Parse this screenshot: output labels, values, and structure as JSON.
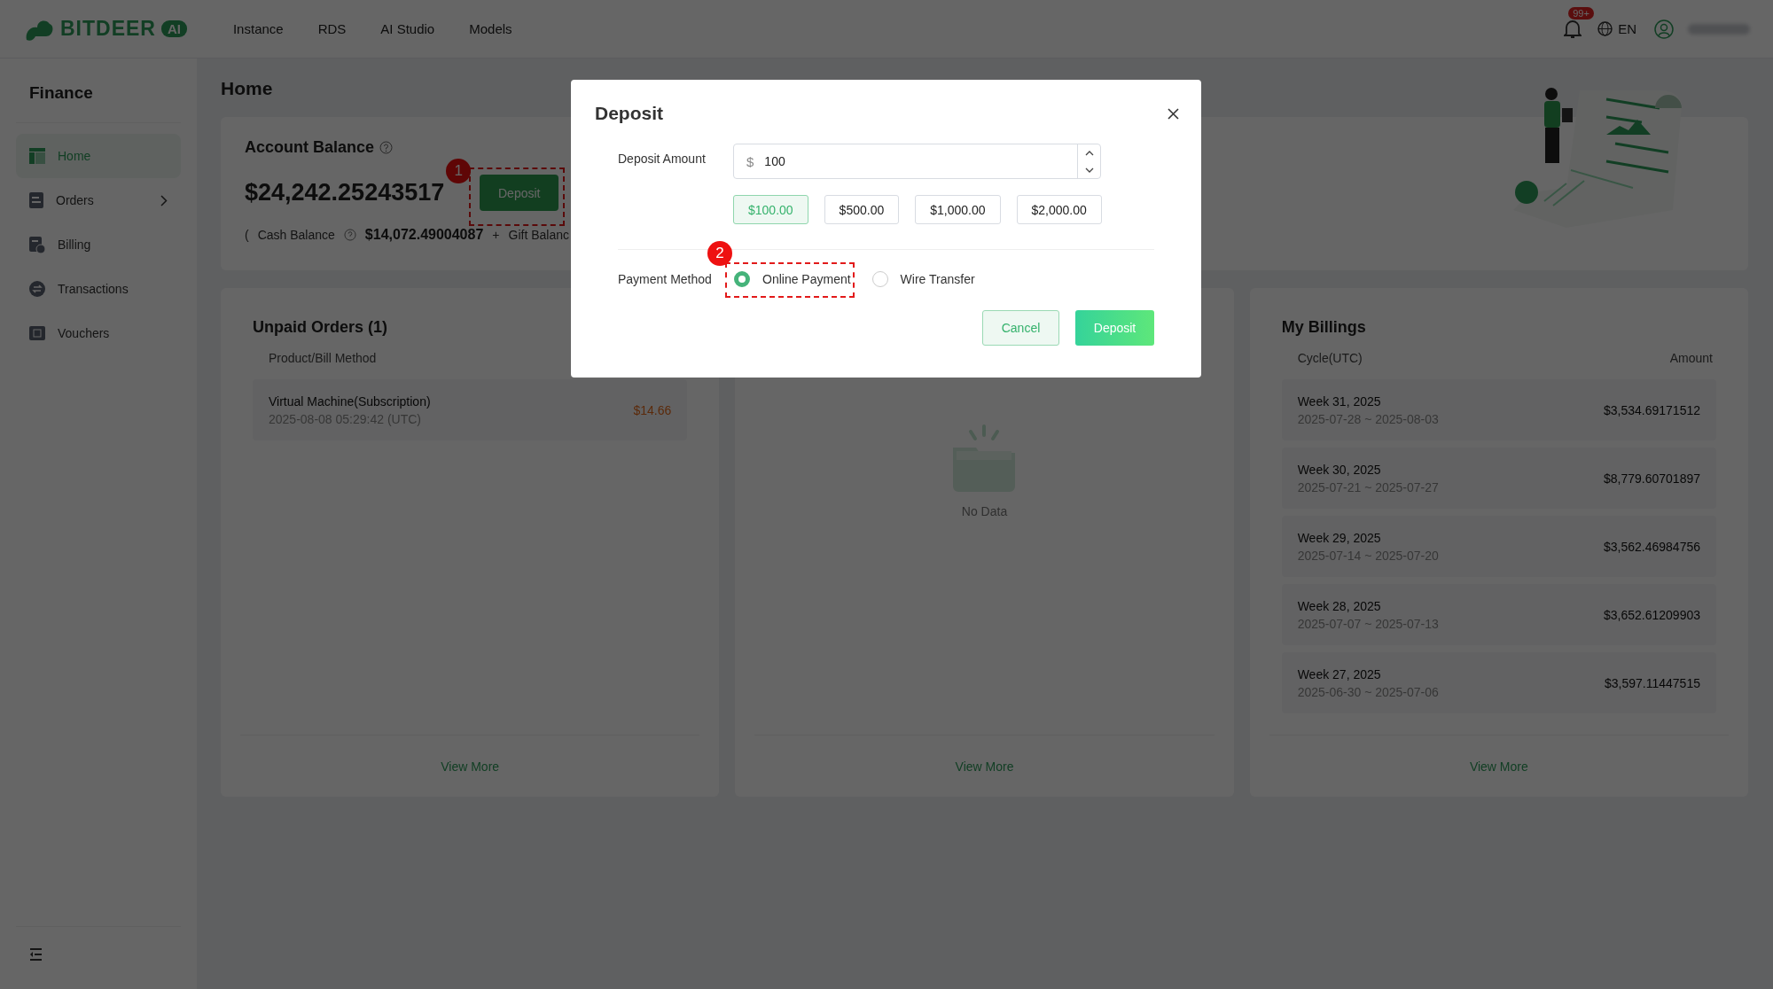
{
  "header": {
    "logo": {
      "text": "BITDEER",
      "badge": "AI"
    },
    "nav": [
      {
        "label": "Instance"
      },
      {
        "label": "RDS"
      },
      {
        "label": "AI Studio"
      },
      {
        "label": "Models"
      }
    ],
    "notifications": {
      "count": "99+"
    },
    "language": "EN"
  },
  "sidebar": {
    "title": "Finance",
    "items": [
      {
        "label": "Home",
        "kind": "home",
        "selected": true,
        "expandable": false
      },
      {
        "label": "Orders",
        "kind": "orders",
        "selected": false,
        "expandable": true
      },
      {
        "label": "Billing",
        "kind": "billing",
        "selected": false,
        "expandable": false
      },
      {
        "label": "Transactions",
        "kind": "transactions",
        "selected": false,
        "expandable": false
      },
      {
        "label": "Vouchers",
        "kind": "vouchers",
        "selected": false,
        "expandable": false
      }
    ]
  },
  "page": {
    "title": "Home"
  },
  "balance": {
    "title": "Account Balance",
    "total": "$24,242.25243517",
    "deposit_button": "Deposit",
    "annotation": "1",
    "open_paren": "(",
    "cash_label": "Cash Balance",
    "cash_value": "$14,072.49004087",
    "plus": "+",
    "gift_label": "Gift Balanc"
  },
  "unpaid_orders": {
    "title": "Unpaid Orders (1)",
    "columns": [
      "Product/Bill Method"
    ],
    "rows": [
      {
        "name": "Virtual Machine(Subscription)",
        "time": "2025-08-08 05:29:42 (UTC)",
        "amount": "$14.66"
      }
    ],
    "footer": "View More"
  },
  "middle_card": {
    "empty_text": "No Data",
    "footer": "View More"
  },
  "billings": {
    "title": "My Billings",
    "columns": [
      "Cycle(UTC)",
      "Amount"
    ],
    "rows": [
      {
        "cycle": "Week 31, 2025",
        "range": "2025-07-28 ~ 2025-08-03",
        "amount": "$3,534.69171512"
      },
      {
        "cycle": "Week 30, 2025",
        "range": "2025-07-21 ~ 2025-07-27",
        "amount": "$8,779.60701897"
      },
      {
        "cycle": "Week 29, 2025",
        "range": "2025-07-14 ~ 2025-07-20",
        "amount": "$3,562.46984756"
      },
      {
        "cycle": "Week 28, 2025",
        "range": "2025-07-07 ~ 2025-07-13",
        "amount": "$3,652.61209903"
      },
      {
        "cycle": "Week 27, 2025",
        "range": "2025-06-30 ~ 2025-07-06",
        "amount": "$3,597.11447515"
      }
    ],
    "footer": "View More"
  },
  "modal": {
    "title": "Deposit",
    "amount_label": "Deposit Amount",
    "currency": "$",
    "amount_value": "100",
    "presets": [
      {
        "label": "$100.00",
        "selected": true
      },
      {
        "label": "$500.00",
        "selected": false
      },
      {
        "label": "$1,000.00",
        "selected": false
      },
      {
        "label": "$2,000.00",
        "selected": false
      }
    ],
    "payment_label": "Payment Method",
    "payment_annotation": "2",
    "payment_options": [
      {
        "label": "Online Payment",
        "selected": true
      },
      {
        "label": "Wire Transfer",
        "selected": false
      }
    ],
    "buttons": [
      {
        "label": "Cancel",
        "kind": "secondary"
      },
      {
        "label": "Deposit",
        "kind": "primary"
      }
    ]
  }
}
